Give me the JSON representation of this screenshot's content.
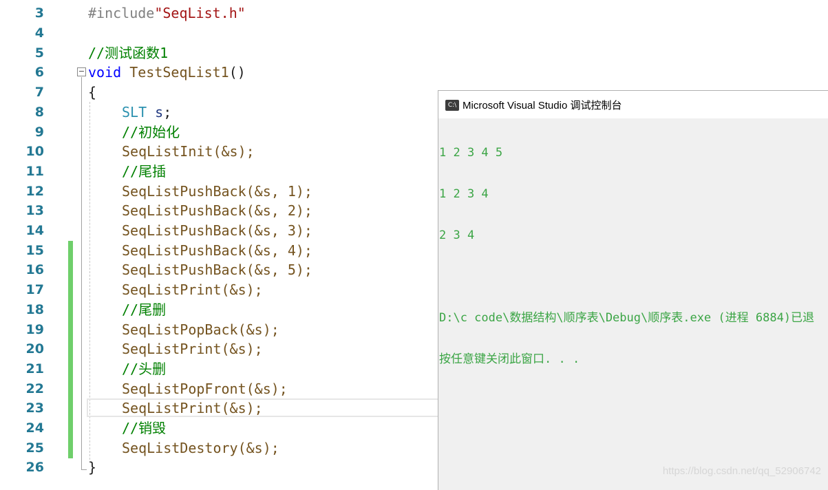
{
  "editor": {
    "lines": [
      {
        "n": "3",
        "c": "#include\"SeqList.h\""
      },
      {
        "n": "4",
        "c": ""
      },
      {
        "n": "5",
        "c": "//测试函数1"
      },
      {
        "n": "6",
        "c": "void TestSeqList1()"
      },
      {
        "n": "7",
        "c": "{"
      },
      {
        "n": "8",
        "c": "SLT s;"
      },
      {
        "n": "9",
        "c": "//初始化"
      },
      {
        "n": "10",
        "c": "SeqListInit(&s);"
      },
      {
        "n": "11",
        "c": "//尾插"
      },
      {
        "n": "12",
        "c": "SeqListPushBack(&s, 1);"
      },
      {
        "n": "13",
        "c": "SeqListPushBack(&s, 2);"
      },
      {
        "n": "14",
        "c": "SeqListPushBack(&s, 3);"
      },
      {
        "n": "15",
        "c": "SeqListPushBack(&s, 4);"
      },
      {
        "n": "16",
        "c": "SeqListPushBack(&s, 5);"
      },
      {
        "n": "17",
        "c": "SeqListPrint(&s);"
      },
      {
        "n": "18",
        "c": "//尾删"
      },
      {
        "n": "19",
        "c": "SeqListPopBack(&s);"
      },
      {
        "n": "20",
        "c": "SeqListPrint(&s);"
      },
      {
        "n": "21",
        "c": "//头删"
      },
      {
        "n": "22",
        "c": "SeqListPopFront(&s);"
      },
      {
        "n": "23",
        "c": "SeqListPrint(&s);"
      },
      {
        "n": "24",
        "c": "//销毁"
      },
      {
        "n": "25",
        "c": "SeqListDestory(&s);"
      },
      {
        "n": "26",
        "c": "}"
      }
    ]
  },
  "console": {
    "title": "Microsoft Visual Studio 调试控制台",
    "icon": "console-app-icon",
    "icon_text": "C:\\",
    "output": [
      "1 2 3 4 5",
      "1 2 3 4",
      "2 3 4",
      "",
      "D:\\c code\\数据结构\\顺序表\\Debug\\顺序表.exe (进程 6884)已退",
      "按任意键关闭此窗口. . ."
    ]
  },
  "watermark": "https://blog.csdn.net/qq_52906742",
  "colors": {
    "linenum": "#237893",
    "keyword": "#0000ff",
    "comment": "#008000",
    "string": "#a31515",
    "output": "#3ba545",
    "change_bar": "#6fcf6b"
  }
}
